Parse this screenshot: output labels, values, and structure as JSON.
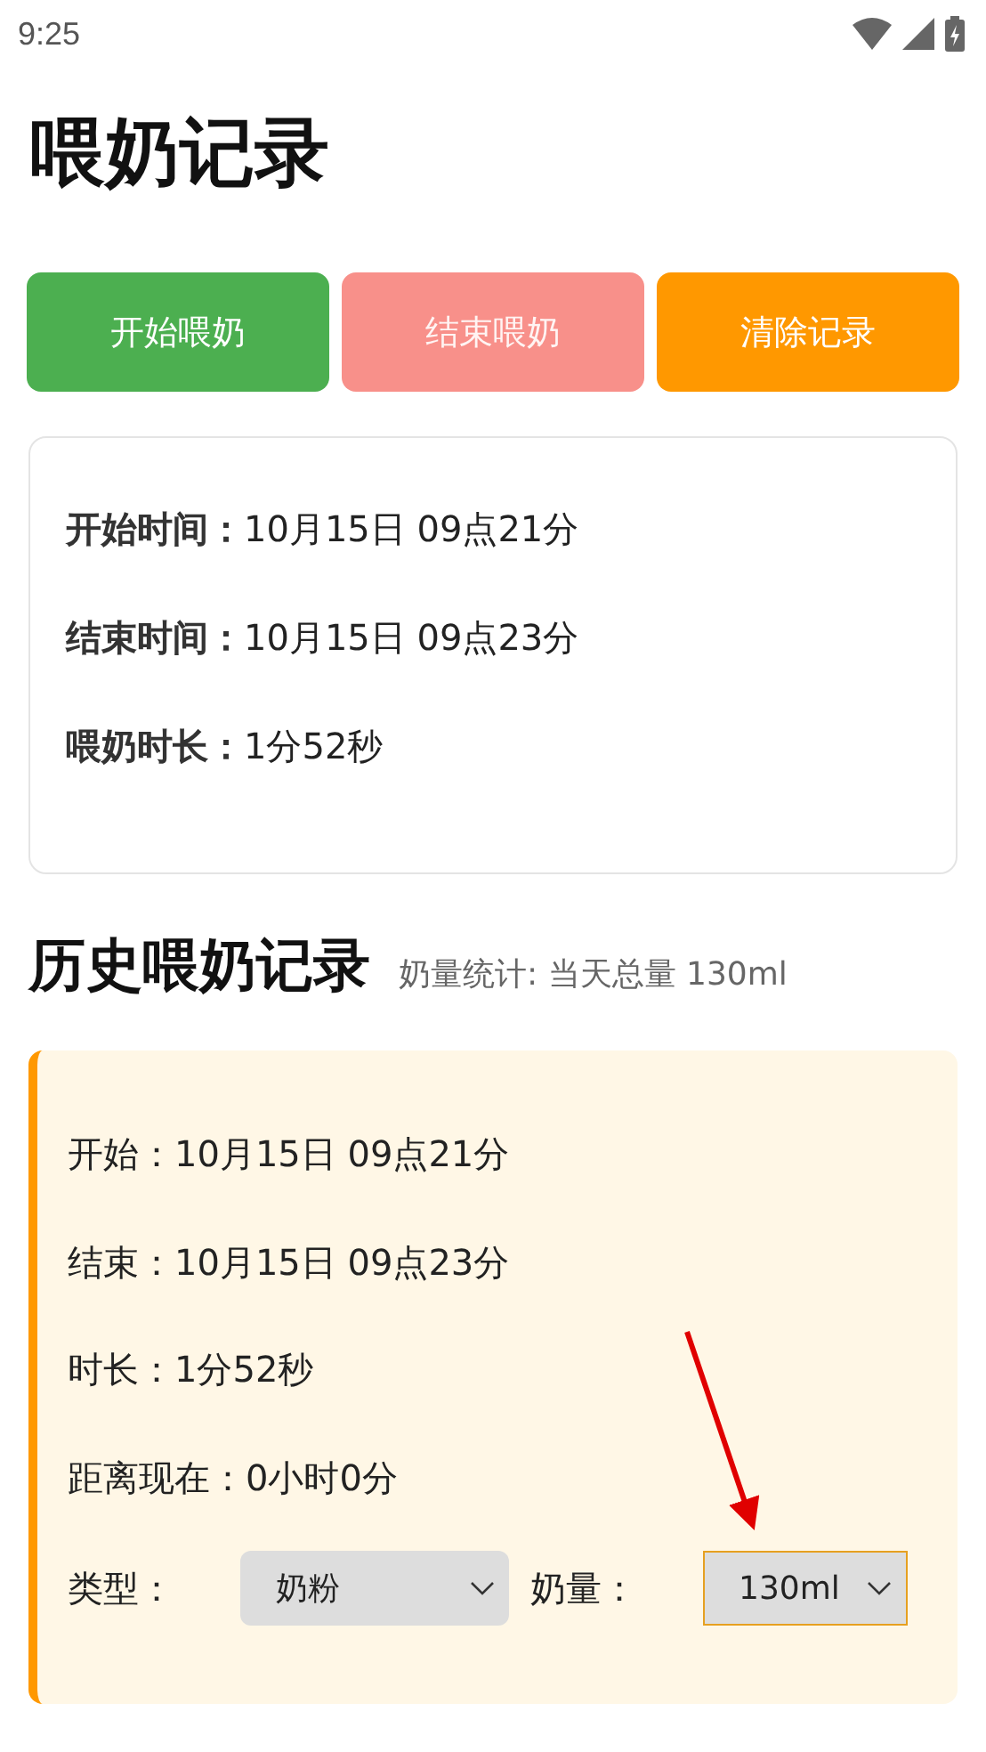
{
  "status_bar": {
    "time": "9:25"
  },
  "title": "喂奶记录",
  "buttons": [
    {
      "label": "开始喂奶",
      "color": "#4caf50",
      "disabled": false
    },
    {
      "label": "结束喂奶",
      "color": "#f8908a",
      "disabled": true
    },
    {
      "label": "清除记录",
      "color": "#ff9800",
      "disabled": false
    }
  ],
  "current": [
    {
      "label": "开始时间：",
      "value": "10月15日 09点21分"
    },
    {
      "label": "结束时间：",
      "value": "10月15日 09点23分"
    },
    {
      "label": "喂奶时长：",
      "value": "1分52秒"
    }
  ],
  "history": {
    "title": "历史喂奶记录",
    "summary": "奶量统计: 当天总量 130ml",
    "records": [
      {
        "lines": [
          {
            "label": "开始：",
            "value": "10月15日 09点21分"
          },
          {
            "label": "结束：",
            "value": "10月15日 09点23分"
          },
          {
            "label": "时长：",
            "value": "1分52秒"
          },
          {
            "label": "距离现在：",
            "value": "0小时0分"
          }
        ],
        "type_label": "类型：",
        "type_value": "奶粉",
        "type_focused": false,
        "amount_label": "奶量：",
        "amount_value": "130ml",
        "amount_focused": true
      }
    ]
  }
}
